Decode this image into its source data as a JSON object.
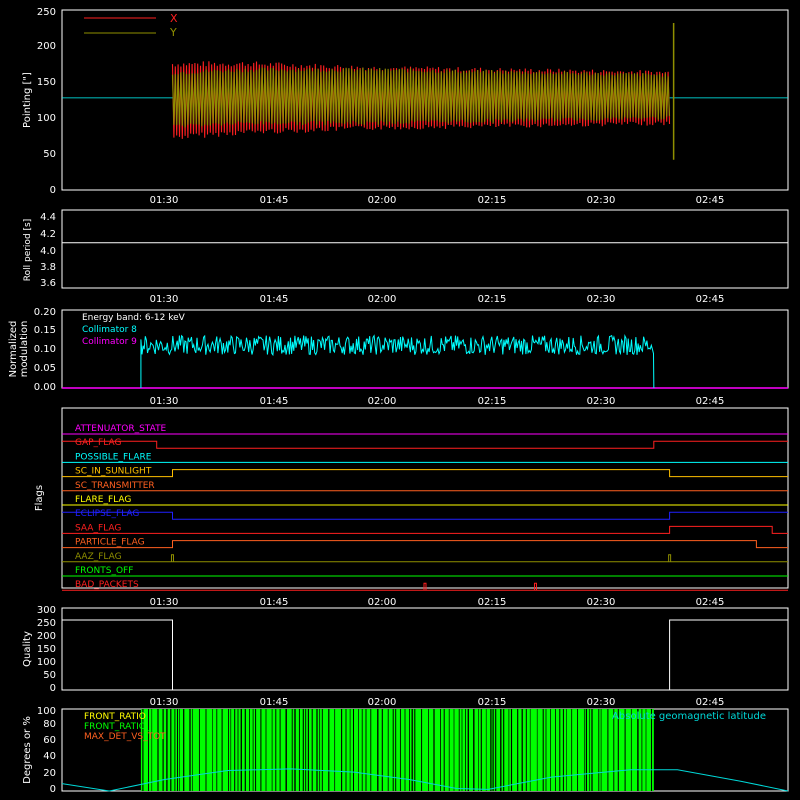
{
  "colors": {
    "background": "#000000",
    "axis": "#ffffff",
    "pointing_x": "#ff2020",
    "pointing_y": "#8f8f00",
    "coll8": "#00ffff",
    "coll9": "#ff00ff",
    "front_ratio": "#00ff00",
    "geomag": "#00d8d8"
  },
  "x_time_ticks": [
    "01:30",
    "01:45",
    "02:00",
    "02:15",
    "02:30",
    "02:45"
  ],
  "chart_data": [
    {
      "type": "line",
      "name": "pointing",
      "ylabel": "Pointing [\"]",
      "ylim": [
        0,
        250
      ],
      "yticks": [
        0,
        50,
        100,
        150,
        200,
        250
      ],
      "x_range": [
        "01:19",
        "02:51"
      ],
      "legend": {
        "placement": "top-left",
        "entries": [
          "X",
          "Y"
        ]
      },
      "series": [
        {
          "name": "X",
          "center": 128,
          "amplitude_start": 55,
          "amplitude_mid": 45,
          "amplitude_end": 38,
          "active_from": "01:33",
          "active_to": "02:36"
        },
        {
          "name": "Y",
          "center": 130,
          "amplitude_start": 40,
          "amplitude_mid": 40,
          "amplitude_end": 32,
          "active_from": "01:33",
          "active_to": "02:36"
        }
      ],
      "baseline_outside_active": 128,
      "end_spike": [
        42,
        232
      ]
    },
    {
      "type": "line",
      "name": "roll",
      "ylabel": "Roll period [s]",
      "ylim": [
        3.5,
        4.5
      ],
      "yticks": [
        "3.6",
        "3.8",
        "4.0",
        "4.2",
        "4.4"
      ],
      "series": [
        {
          "name": "Roll period",
          "value": 4.08
        }
      ]
    },
    {
      "type": "line",
      "name": "modulation",
      "ylabel": [
        "Normalized",
        "modulation"
      ],
      "ylim": [
        0,
        0.2
      ],
      "yticks": [
        "0.00",
        "0.05",
        "0.10",
        "0.15",
        "0.20"
      ],
      "annotation": "Energy band: 6-12 keV",
      "series": [
        {
          "name": "Collimator 8",
          "active_from": "01:29",
          "active_to": "02:34",
          "mean": 0.11,
          "spread": 0.025
        },
        {
          "name": "Collimator 9",
          "value": 0.0
        }
      ]
    },
    {
      "type": "line",
      "name": "flags",
      "ylabel": "Flags",
      "series": [
        {
          "name": "ATTENUATOR_STATE",
          "color": "#ff00ff",
          "segments": [
            [
              "01:19",
              "02:51",
              0
            ]
          ]
        },
        {
          "name": "GAP_FLAG",
          "color": "#ff2020",
          "segments": [
            [
              "01:19",
              "01:31",
              1
            ],
            [
              "01:31",
              "02:34",
              0
            ],
            [
              "02:34",
              "02:51",
              1
            ]
          ]
        },
        {
          "name": "POSSIBLE_FLARE",
          "color": "#00ffff",
          "segments": [
            [
              "01:19",
              "02:51",
              0
            ]
          ]
        },
        {
          "name": "SC_IN_SUNLIGHT",
          "color": "#ffc000",
          "segments": [
            [
              "01:19",
              "01:33",
              0
            ],
            [
              "01:33",
              "02:36",
              1
            ],
            [
              "02:36",
              "02:51",
              0
            ]
          ]
        },
        {
          "name": "SC_TRANSMITTER",
          "color": "#ff6020",
          "segments": [
            [
              "01:19",
              "02:51",
              0
            ]
          ]
        },
        {
          "name": "FLARE_FLAG",
          "color": "#ffff00",
          "segments": [
            [
              "01:19",
              "02:51",
              0
            ]
          ]
        },
        {
          "name": "ECLIPSE_FLAG",
          "color": "#2020ff",
          "segments": [
            [
              "01:19",
              "01:33",
              1
            ],
            [
              "01:33",
              "02:36",
              0
            ],
            [
              "02:36",
              "02:51",
              1
            ]
          ]
        },
        {
          "name": "SAA_FLAG",
          "color": "#ff2020",
          "segments": [
            [
              "01:19",
              "02:36",
              0
            ],
            [
              "02:36",
              "02:49",
              1
            ],
            [
              "02:49",
              "02:51",
              0
            ]
          ]
        },
        {
          "name": "PARTICLE_FLAG",
          "color": "#ff6020",
          "segments": [
            [
              "01:19",
              "01:33",
              0
            ],
            [
              "01:33",
              "02:47",
              1
            ],
            [
              "02:47",
              "02:51",
              0
            ]
          ]
        },
        {
          "name": "AAZ_FLAG",
          "color": "#8f8f00",
          "segments": [
            [
              "01:19",
              "02:51",
              0
            ]
          ],
          "pulses": [
            "01:33",
            "02:36"
          ]
        },
        {
          "name": "FRONTS_OFF",
          "color": "#00ff00",
          "segments": [
            [
              "01:19",
              "02:51",
              0
            ]
          ]
        },
        {
          "name": "BAD_PACKETS",
          "color": "#ff2020",
          "segments": [
            [
              "01:19",
              "02:51",
              0
            ]
          ],
          "pulses": [
            "02:05",
            "02:19"
          ]
        }
      ]
    },
    {
      "type": "line",
      "name": "quality",
      "ylabel": "Quality",
      "ylim": [
        0,
        300
      ],
      "yticks": [
        0,
        50,
        100,
        150,
        200,
        250,
        300
      ],
      "series": [
        {
          "name": "Quality",
          "segments": [
            [
              "01:19",
              "01:33",
              256
            ],
            [
              "01:33",
              "02:36",
              0
            ],
            [
              "02:36",
              "02:51",
              256
            ]
          ]
        }
      ]
    },
    {
      "type": "line",
      "name": "degrees",
      "ylabel": "Degrees or %",
      "ylim": [
        0,
        100
      ],
      "yticks": [
        0,
        20,
        40,
        60,
        80,
        100
      ],
      "legend": {
        "placement": "top-left",
        "entries": [
          "FRONT_RATIO",
          "FRONT_RATIO_",
          "MAX_DET_VS_TOT"
        ]
      },
      "annotation_right": "Absolute geomagnetic latitude",
      "front_ratio_band": {
        "from": "01:29",
        "to": "02:34",
        "value": 100
      },
      "geomag_latitude": [
        {
          "t": "01:19",
          "v": 9
        },
        {
          "t": "01:25",
          "v": 0
        },
        {
          "t": "01:32",
          "v": 14
        },
        {
          "t": "01:40",
          "v": 25
        },
        {
          "t": "01:48",
          "v": 27
        },
        {
          "t": "01:56",
          "v": 23
        },
        {
          "t": "02:03",
          "v": 14
        },
        {
          "t": "02:09",
          "v": 3
        },
        {
          "t": "02:13",
          "v": 2
        },
        {
          "t": "02:21",
          "v": 17
        },
        {
          "t": "02:31",
          "v": 26
        },
        {
          "t": "02:37",
          "v": 26
        },
        {
          "t": "02:45",
          "v": 12
        },
        {
          "t": "02:51",
          "v": 0
        }
      ]
    }
  ]
}
